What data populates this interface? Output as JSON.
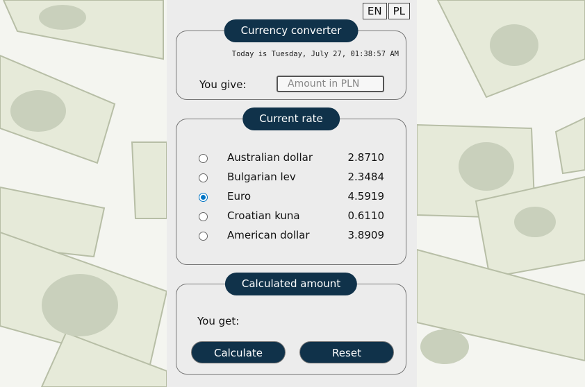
{
  "language_buttons": [
    "EN",
    "PL"
  ],
  "converter": {
    "title": "Currency converter",
    "date_text": "Today is Tuesday, July 27, 01:38:57 AM",
    "give_label": "You give:",
    "amount_placeholder": "Amount in PLN"
  },
  "rates": {
    "title": "Current rate",
    "items": [
      {
        "name": "Australian dollar",
        "value": "2.8710",
        "selected": false
      },
      {
        "name": "Bulgarian lev",
        "value": "2.3484",
        "selected": false
      },
      {
        "name": "Euro",
        "value": "4.5919",
        "selected": true
      },
      {
        "name": "Croatian kuna",
        "value": "0.6110",
        "selected": false
      },
      {
        "name": "American dollar",
        "value": "3.8909",
        "selected": false
      }
    ]
  },
  "result": {
    "title": "Calculated amount",
    "get_label": "You get:",
    "calculate_label": "Calculate",
    "reset_label": "Reset"
  },
  "colors": {
    "accent": "#10324a",
    "panel": "#ececec",
    "radio_selected": "#0075c5"
  }
}
